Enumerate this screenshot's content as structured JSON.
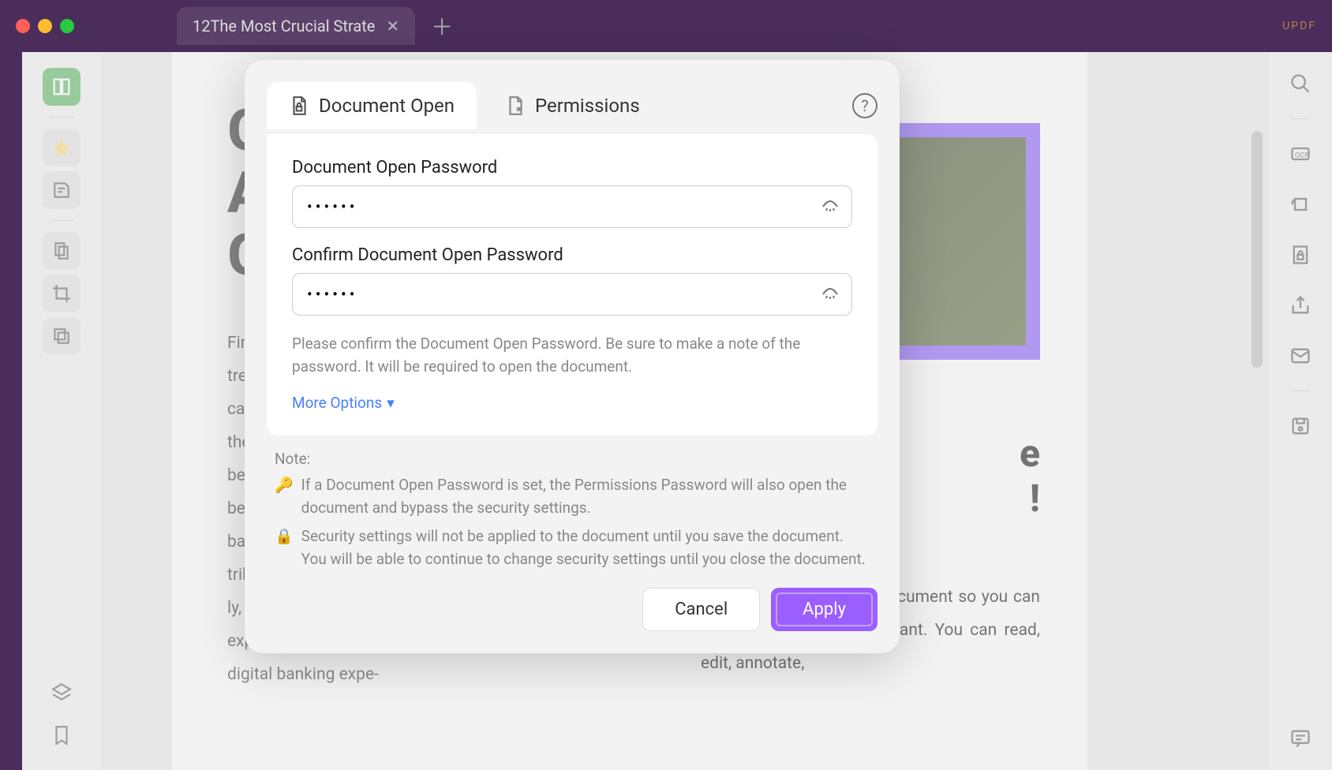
{
  "titlebar": {
    "tab_title": "12The Most Crucial Strate",
    "brand": "UPDF"
  },
  "left_tools": [
    "reader",
    "highlight",
    "annotate",
    "page-ocr",
    "crop",
    "redact",
    "layers",
    "bookmark"
  ],
  "right_tools": [
    "search",
    "ocr",
    "rotate",
    "lock",
    "share",
    "mail",
    "save",
    "comment"
  ],
  "document": {
    "heading_prefix": "G",
    "heading_line2": "A",
    "heading_line3": "Gr",
    "body_left": "Finan\ntrend\ncarbo\ntheir\nbeing\nbecon\nbanki\ntribut\nly, it will support achieving consumer expectations for a great, safe, and tailored digital banking expe-",
    "right_heading_1": "e",
    "right_heading_2": "!",
    "right_body": "pletely digitalizes every document so you can perform any action you want. You can read, edit, annotate,"
  },
  "modal": {
    "tabs": {
      "document_open": "Document Open",
      "permissions": "Permissions"
    },
    "field1_label": "Document Open Password",
    "field1_value": "••••••",
    "field2_label": "Confirm Document Open Password",
    "field2_value": "••••••",
    "helper": "Please confirm the Document Open Password. Be sure to make a note of the password. It will be required to open the document.",
    "more_options": "More Options",
    "note_label": "Note:",
    "note1": "If a Document Open Password is set, the Permissions Password will also open the document and bypass the security settings.",
    "note2": "Security settings will not be applied to the document until you save the document. You will be able to continue to change security settings until you close the document.",
    "cancel": "Cancel",
    "apply": "Apply"
  }
}
